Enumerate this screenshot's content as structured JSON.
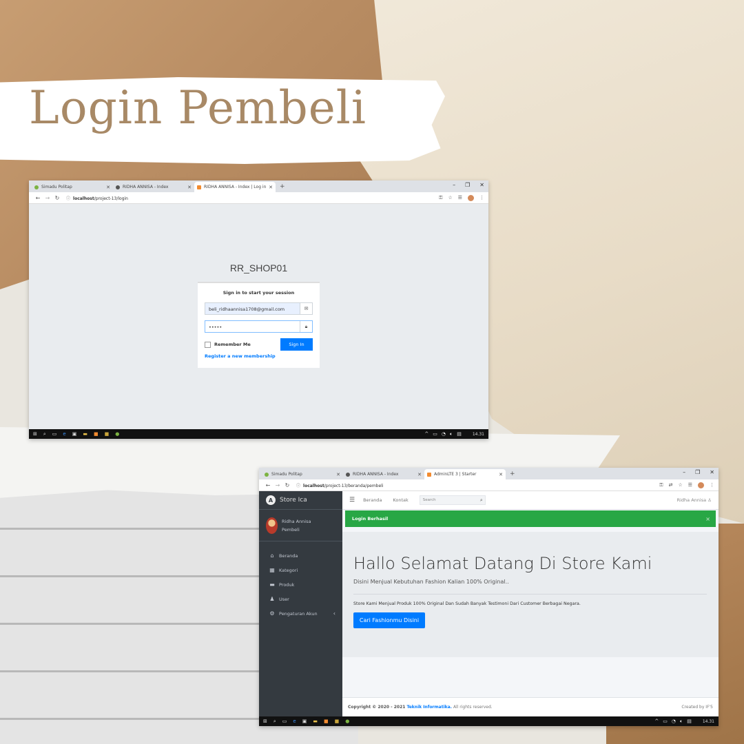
{
  "page": {
    "heading": "Login Pembeli"
  },
  "login_window": {
    "tabs": [
      {
        "label": "Simadu Politap",
        "favicon_color": "#7cb342"
      },
      {
        "label": "RIDHA ANNISA - Index",
        "favicon_color": "#555555"
      },
      {
        "label": "RIDHA ANNISA - Index | Log in",
        "favicon_color": "#f28b30"
      }
    ],
    "url_host": "localhost",
    "url_path": "/project-13/login",
    "brand": "RR_SHOP01",
    "login_msg": "Sign in to start your session",
    "email_value": "beli_ridhaannisa1708@gmail.com",
    "password_value": "•••••",
    "remember_label": "Remember Me",
    "signin_label": "Sign In",
    "register_label": "Register a new membership",
    "clock": "14.31"
  },
  "home_window": {
    "tabs": [
      {
        "label": "Simadu Politap",
        "favicon_color": "#7cb342"
      },
      {
        "label": "RIDHA ANNISA - Index",
        "favicon_color": "#555555"
      },
      {
        "label": "AdminLTE 3 | Starter",
        "favicon_color": "#f28b30"
      }
    ],
    "url_host": "localhost",
    "url_path": "/project-13/beranda/pembeli",
    "sidebar": {
      "brand": "Store Ica",
      "user_name": "Ridha Annisa Pembeli",
      "items": [
        {
          "label": "Beranda",
          "icon": "home-icon"
        },
        {
          "label": "Kategori",
          "icon": "grid-icon"
        },
        {
          "label": "Produk",
          "icon": "box-icon"
        },
        {
          "label": "User",
          "icon": "user-icon"
        },
        {
          "label": "Pengaturan Akun",
          "icon": "gear-icon"
        }
      ]
    },
    "topnav": {
      "links": [
        "Beranda",
        "Kontak"
      ],
      "search_placeholder": "Search",
      "user": "Ridha Annisa"
    },
    "alert": "Login Berhasil",
    "jumbotron": {
      "title": "Hallo Selamat Datang Di Store Kami",
      "lead": "Disini Menjual Kebutuhan Fashion Kalian 100% Original..",
      "text": "Store Kami Menjual Produk 100% Original Dan Sudah Banyak Testimoni Dari Customer Berbagai Negara.",
      "button": "Cari Fashionmu Disini"
    },
    "footer": {
      "copyright": "Copyright © 2020 - 2021",
      "link": "Teknik Informatika.",
      "rights": "All rights reserved.",
      "created": "Created by IF'5"
    },
    "clock": "14.31"
  },
  "colors": {
    "accent_heading": "#a88966",
    "primary": "#007bff",
    "success": "#28a745",
    "sidebar": "#343a40"
  }
}
